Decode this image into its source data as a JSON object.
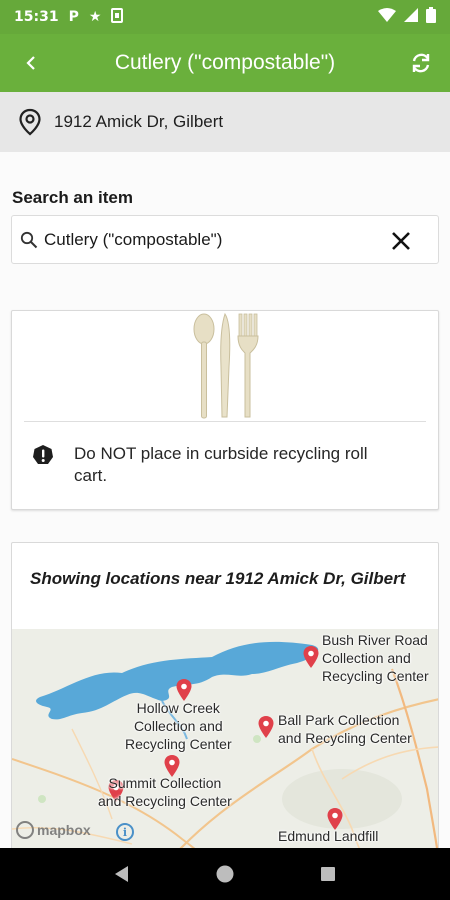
{
  "status_bar": {
    "time": "15:31",
    "icons": [
      "parking-icon",
      "star-icon",
      "sim-card-icon"
    ],
    "right_icons": [
      "wifi-icon",
      "signal-icon",
      "battery-icon"
    ]
  },
  "app_bar": {
    "title": "Cutlery (\"compostable\")",
    "back_icon": "chevron-left-icon",
    "refresh_icon": "refresh-icon",
    "color": "#6ab03c"
  },
  "location": {
    "icon": "map-pin-icon",
    "address": "1912 Amick Dr, Gilbert"
  },
  "search": {
    "label": "Search an item",
    "value": "Cutlery (\"compostable\")",
    "search_icon": "search-icon",
    "clear_icon": "close-icon"
  },
  "item": {
    "image": "compostable-cutlery-image",
    "notice_icon": "alert-icon",
    "notice": "Do NOT place in curbside recycling roll cart."
  },
  "map": {
    "heading": "Showing locations near 1912 Amick Dr, Gilbert",
    "locations": [
      {
        "name_line1": "Bush River Road",
        "name_line2": "Collection and",
        "name_line3": "Recycling Center"
      },
      {
        "name_line1": "Hollow Creek",
        "name_line2": "Collection and",
        "name_line3": "Recycling Center"
      },
      {
        "name_line1": "Ball Park Collection",
        "name_line2": "and Recycling Center"
      },
      {
        "name_line1": "Summit Collection",
        "name_line2": "and Recycling Center"
      },
      {
        "name_line1": "Edmund Landfill"
      }
    ],
    "attribution": "mapbox",
    "info_icon": "info-icon"
  },
  "nav": {
    "back": "nav-back-icon",
    "home": "nav-home-icon",
    "recents": "nav-recents-icon"
  }
}
